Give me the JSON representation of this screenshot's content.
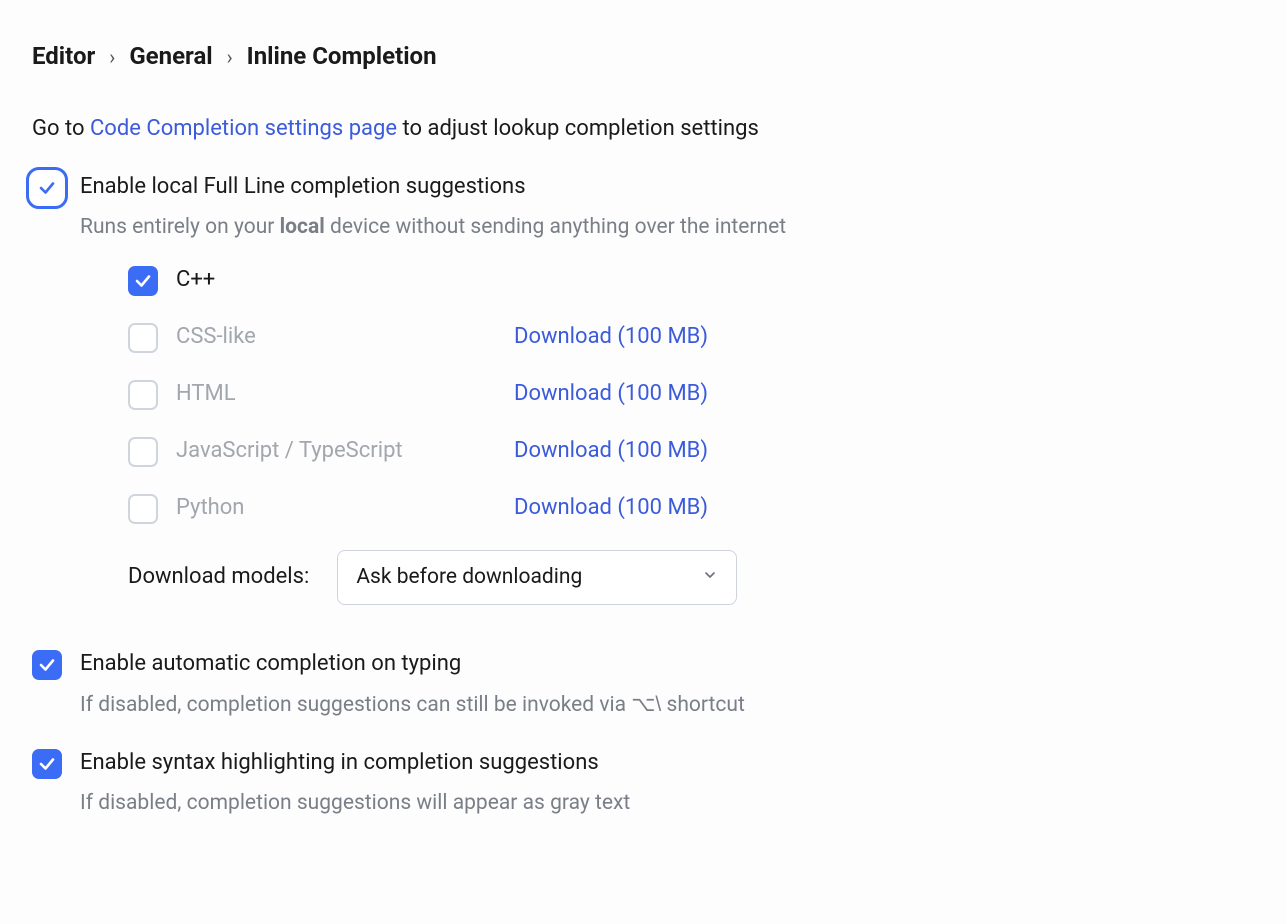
{
  "breadcrumb": {
    "a": "Editor",
    "b": "General",
    "c": "Inline Completion"
  },
  "intro": {
    "prefix": "Go to ",
    "link": "Code Completion settings page",
    "suffix": " to adjust lookup completion settings"
  },
  "fullline": {
    "label": "Enable local Full Line completion suggestions",
    "desc_pre": "Runs entirely on your ",
    "desc_bold": "local",
    "desc_post": " device without sending anything over the internet"
  },
  "langs": [
    {
      "name": "C++",
      "checked": true,
      "download": ""
    },
    {
      "name": "CSS-like",
      "checked": false,
      "download": "Download (100 MB)"
    },
    {
      "name": "HTML",
      "checked": false,
      "download": "Download (100 MB)"
    },
    {
      "name": "JavaScript / TypeScript",
      "checked": false,
      "download": "Download (100 MB)"
    },
    {
      "name": "Python",
      "checked": false,
      "download": "Download (100 MB)"
    }
  ],
  "models": {
    "label": "Download models:",
    "value": "Ask before downloading"
  },
  "auto": {
    "label": "Enable automatic completion on typing",
    "desc_pre": "If disabled, completion suggestions can still be invoked via ",
    "shortcut": "⌥\\",
    "desc_post": " shortcut"
  },
  "syntax": {
    "label": "Enable syntax highlighting in completion suggestions",
    "desc": "If disabled, completion suggestions will appear as gray text"
  }
}
